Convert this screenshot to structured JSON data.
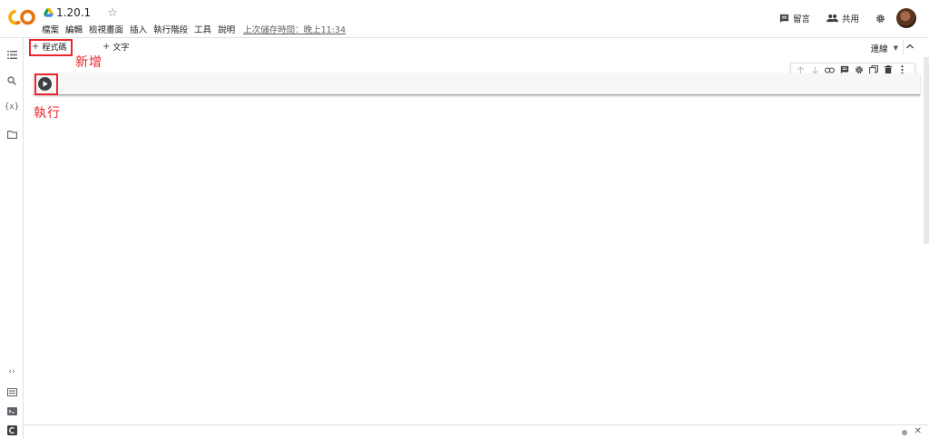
{
  "header": {
    "title": "1.20.1",
    "menu": [
      "檔案",
      "編輯",
      "檢視畫面",
      "插入",
      "執行階段",
      "工具",
      "說明"
    ],
    "last_saved": "上次儲存時間：晚上11:34",
    "comment_label": "留言",
    "share_label": "共用"
  },
  "toolbar": {
    "add_code_label": "程式碼",
    "add_text_label": "文字",
    "connect_label": "連線"
  },
  "annotations": {
    "add_note": "新增",
    "run_note": "執行"
  },
  "colors": {
    "highlight": "#e8262c",
    "logo_orange": "#f9ab00",
    "logo_dark_orange": "#e8710a",
    "drive_green": "#0f9d58",
    "drive_blue": "#4285f4",
    "drive_yellow": "#f4b400"
  }
}
